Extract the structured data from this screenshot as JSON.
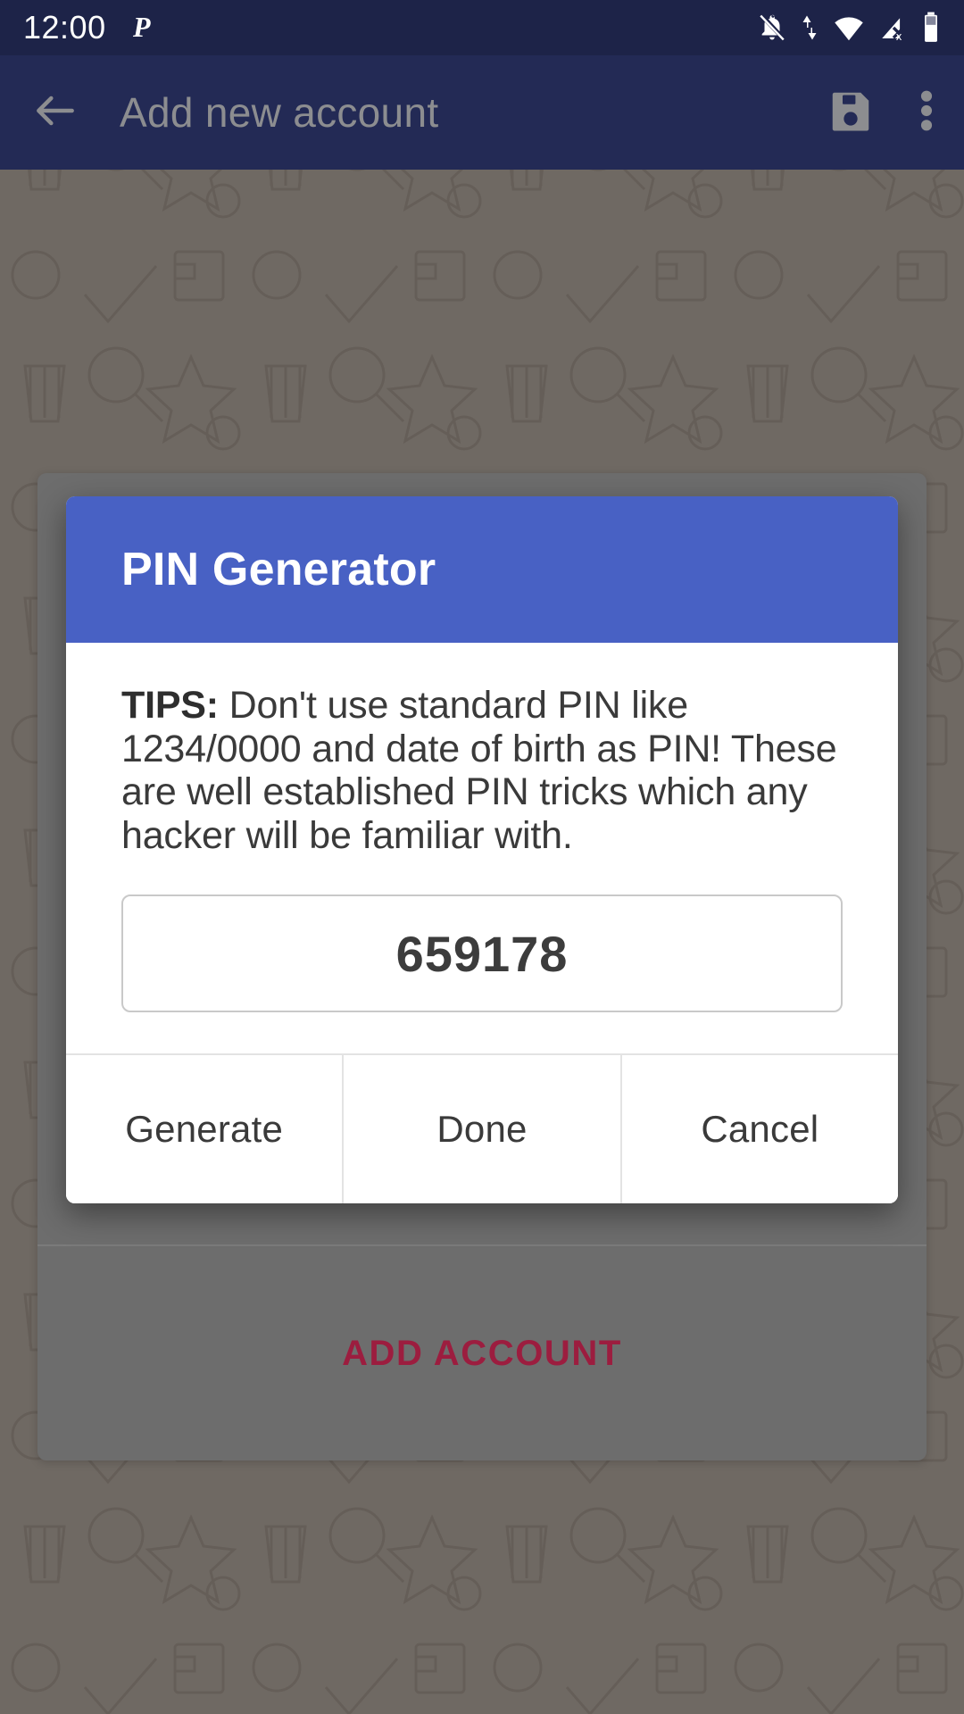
{
  "status_bar": {
    "time": "12:00",
    "app_indicator_icon": "p-letter-icon",
    "icons": [
      "notifications-off-icon",
      "data-transfer-icon",
      "wifi-icon",
      "signal-no-service-icon",
      "battery-icon"
    ]
  },
  "app_bar": {
    "back_icon": "back-arrow-icon",
    "title": "Add new account",
    "save_icon": "save-floppy-icon",
    "overflow_icon": "overflow-menu-icon"
  },
  "content": {
    "add_account_label": "ADD ACCOUNT"
  },
  "dialog": {
    "title": "PIN Generator",
    "tips_label": "TIPS:",
    "tips_body": " Don't use standard PIN like 1234/0000 and date of birth as PIN! These are well established PIN tricks which any hacker will be familiar with.",
    "pin_value": "659178",
    "buttons": [
      {
        "label": "Generate",
        "name": "generate-button"
      },
      {
        "label": "Done",
        "name": "done-button"
      },
      {
        "label": "Cancel",
        "name": "cancel-button"
      }
    ]
  },
  "colors": {
    "status_bar_bg": "#1d2348",
    "app_bar_bg": "#232a55",
    "dialog_accent": "#4861c4",
    "add_account_text": "#9c1d3f",
    "scrim_bg": "#6d6d6d",
    "wallpaper_bg": "#6f6963"
  }
}
